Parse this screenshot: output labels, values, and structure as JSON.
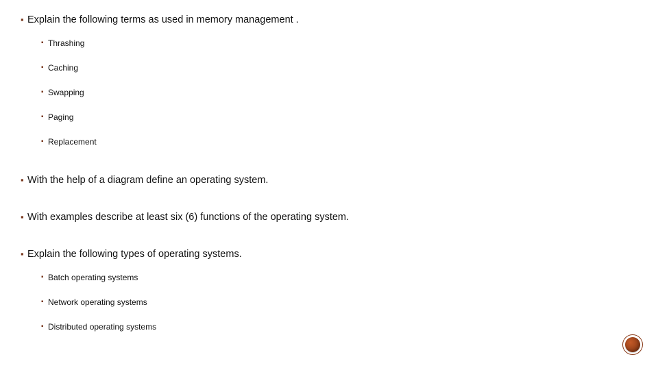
{
  "bullet_glyph": "▪",
  "items": [
    {
      "text": "Explain the following terms as used in memory management .",
      "sub": [
        {
          "text": "Thrashing"
        },
        {
          "text": "Caching"
        },
        {
          "text": "Swapping"
        },
        {
          "text": "Paging"
        },
        {
          "text": "Replacement"
        }
      ]
    },
    {
      "text": "With the help of a diagram define an operating system."
    },
    {
      "text": "With examples describe at least six (6) functions of the operating system."
    },
    {
      "text": "Explain the following types of operating systems.",
      "sub": [
        {
          "text": "Batch operating systems"
        },
        {
          "text": "Network operating systems"
        },
        {
          "text": "Distributed operating systems"
        }
      ]
    }
  ]
}
